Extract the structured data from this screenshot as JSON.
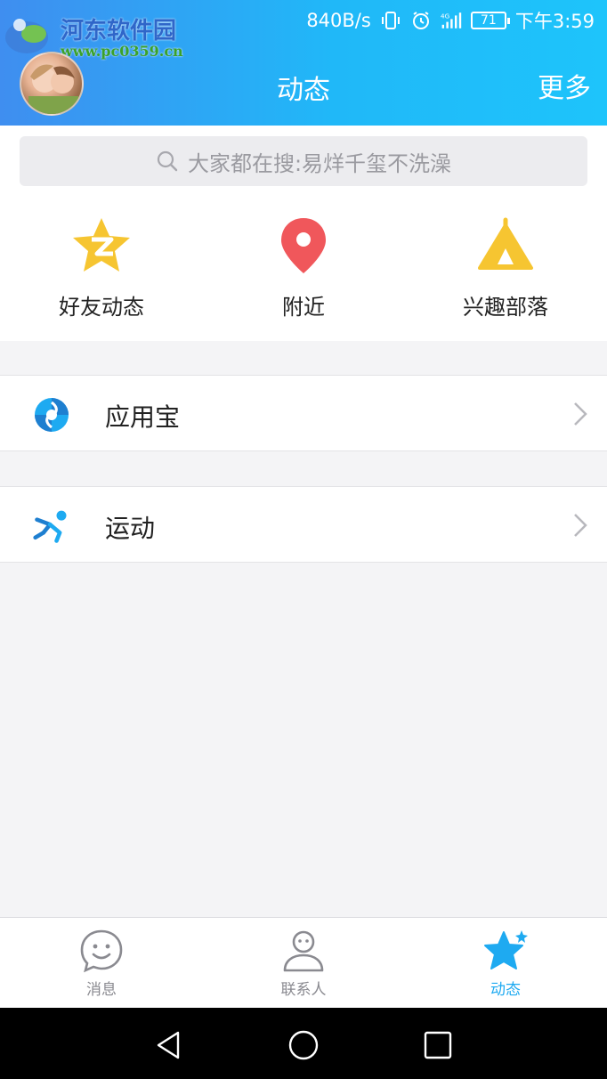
{
  "status_bar": {
    "net_speed": "840B/s",
    "network": "4G",
    "battery": "71",
    "time": "下午3:59"
  },
  "watermark": {
    "title": "河东软件园",
    "url": "www.pc0359.cn"
  },
  "header": {
    "title": "动态",
    "more": "更多"
  },
  "search": {
    "placeholder": "大家都在搜:易烊千玺不洗澡"
  },
  "quick_entries": [
    {
      "label": "好友动态",
      "icon": "qzone-star-icon",
      "color": "#f6c531"
    },
    {
      "label": "附近",
      "icon": "location-pin-icon",
      "color": "#f0575b"
    },
    {
      "label": "兴趣部落",
      "icon": "tent-icon",
      "color": "#f6c531"
    }
  ],
  "list": [
    {
      "label": "应用宝",
      "icon": "app-store-icon"
    },
    {
      "label": "运动",
      "icon": "running-icon"
    }
  ],
  "tabs": [
    {
      "label": "消息",
      "icon": "smile-chat-icon",
      "active": false
    },
    {
      "label": "联系人",
      "icon": "person-icon",
      "active": false
    },
    {
      "label": "动态",
      "icon": "star-icon",
      "active": true
    }
  ],
  "colors": {
    "accent": "#1eaaf1",
    "header_start": "#3f8ef0",
    "header_end": "#1ec4fb",
    "background": "#f4f4f6"
  }
}
